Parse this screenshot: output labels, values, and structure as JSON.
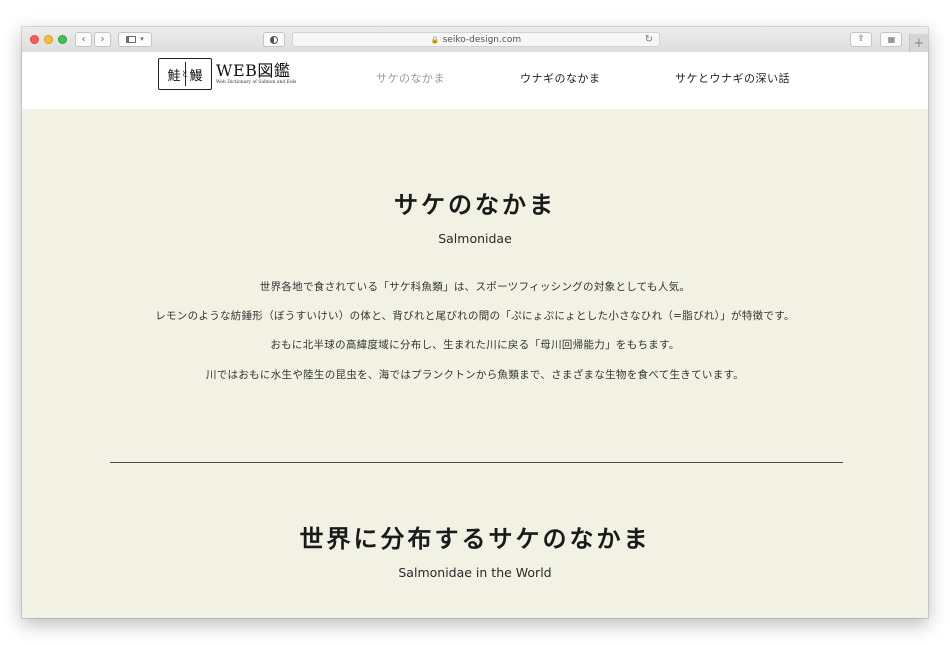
{
  "browser": {
    "url": "seiko-design.com",
    "new_tab": "+"
  },
  "site": {
    "logo": {
      "kanji_left": "鮭",
      "kanji_middle": "と",
      "kanji_right": "鰻",
      "title": "WEB図鑑",
      "subtitle": "Web Dictionary of Salmon and Eels"
    },
    "nav": [
      {
        "label": "サケのなかま",
        "active": true
      },
      {
        "label": "ウナギのなかま",
        "active": false
      },
      {
        "label": "サケとウナギの深い話",
        "active": false
      }
    ]
  },
  "section1": {
    "title": "サケのなかま",
    "subtitle": "Salmonidae",
    "paragraphs": [
      "世界各地で食されている「サケ科魚類」は、スポーツフィッシングの対象としても人気。",
      "レモンのような紡錘形（ぼうすいけい）の体と、背びれと尾びれの間の「ぷにょぷにょとした小さなひれ（=脂びれ）」が特徴です。",
      "おもに北半球の高緯度域に分布し、生まれた川に戻る「母川回帰能力」をもちます。",
      "川ではおもに水生や陸生の昆虫を、海ではプランクトンから魚類まで、さまざまな生物を食べて生きています。"
    ]
  },
  "section2": {
    "title": "世界に分布するサケのなかま",
    "subtitle": "Salmonidae in the World"
  }
}
